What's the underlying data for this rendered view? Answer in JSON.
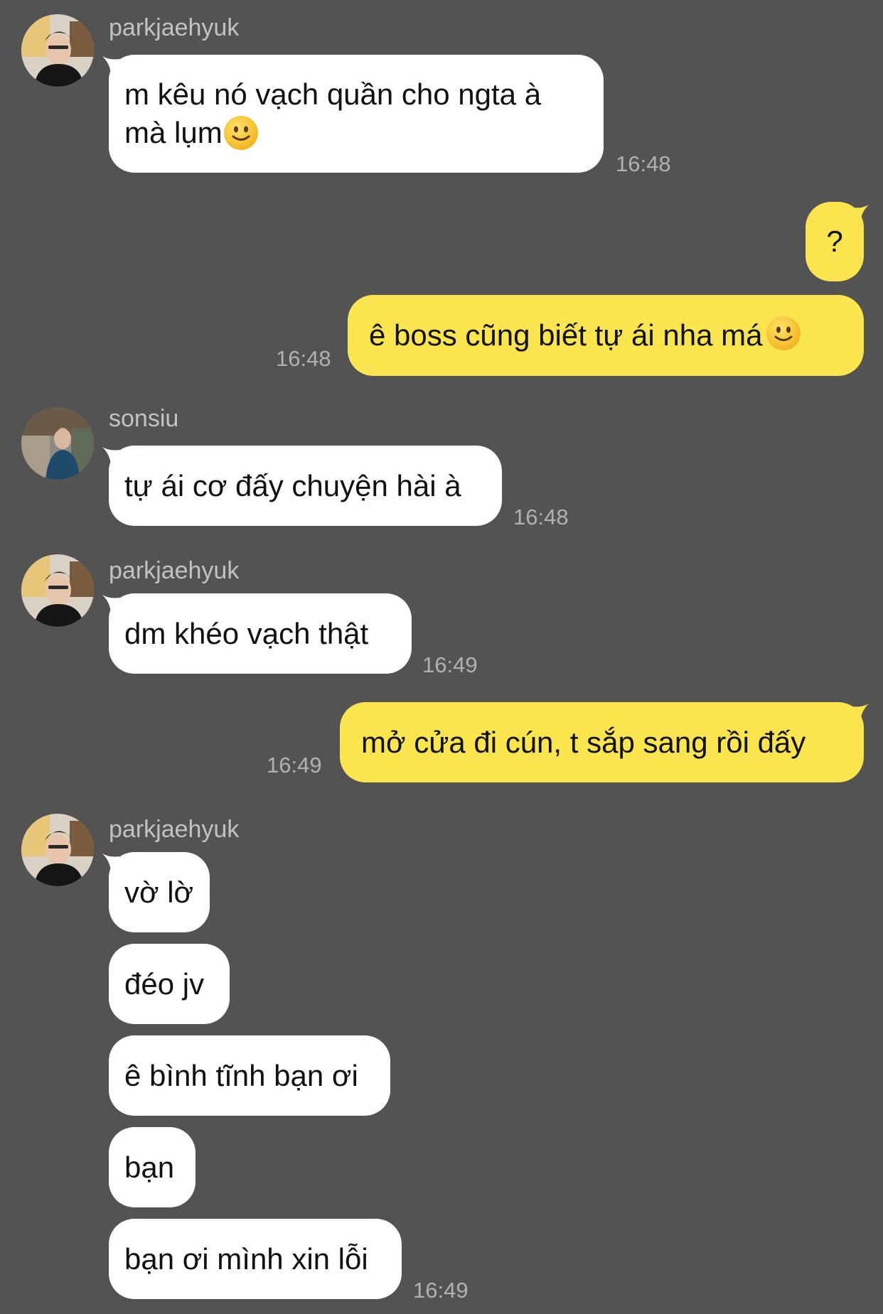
{
  "messages": {
    "g1": {
      "sender": "parkjaehyuk",
      "line1": "m kêu nó vạch quần cho ngta à",
      "line2": "mà lụm",
      "time": "16:48"
    },
    "me1": {
      "text": "?"
    },
    "me2": {
      "text": "ê boss cũng biết tự ái nha má",
      "time": "16:48"
    },
    "g2": {
      "sender": "sonsiu",
      "text": "tự ái cơ đấy chuyện hài à",
      "time": "16:48"
    },
    "g3": {
      "sender": "parkjaehyuk",
      "text": "dm khéo vạch thật",
      "time": "16:49"
    },
    "me3": {
      "text": "mở cửa đi cún, t sắp sang rồi đấy",
      "time": "16:49"
    },
    "g4": {
      "sender": "parkjaehyuk",
      "texts": [
        "vờ lờ",
        "đéo jv",
        "ê bình tĩnh bạn ơi",
        "bạn",
        "bạn ơi mình xin lỗi"
      ],
      "time": "16:49"
    }
  },
  "icons": {
    "emoji": "slightly-smiling-face-icon",
    "avatar_a": "avatar-parkjaehyuk",
    "avatar_b": "avatar-sonsiu"
  },
  "colors": {
    "background": "#545354",
    "incoming": "#ffffff",
    "outgoing": "#fbe54e"
  }
}
